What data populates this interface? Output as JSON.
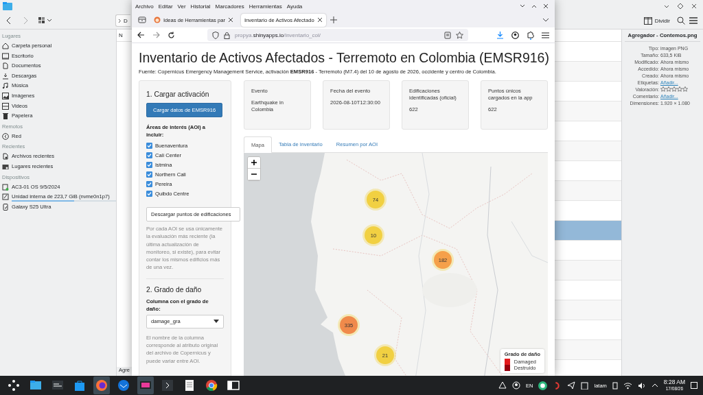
{
  "file_manager": {
    "breadcrumb": "D",
    "split_button": "Dividir",
    "column_header": "N",
    "status": "Agre",
    "places": [
      {
        "heading": "Lugares",
        "items": [
          {
            "label": "Carpeta personal",
            "kind": "home"
          },
          {
            "label": "Escritorio",
            "kind": "desktop"
          },
          {
            "label": "Documentos",
            "kind": "documents"
          },
          {
            "label": "Descargas",
            "kind": "downloads"
          },
          {
            "label": "Música",
            "kind": "music"
          },
          {
            "label": "Imágenes",
            "kind": "pictures"
          },
          {
            "label": "Videos",
            "kind": "videos"
          },
          {
            "label": "Papelera",
            "kind": "trash"
          }
        ]
      },
      {
        "heading": "Remotos",
        "items": [
          {
            "label": "Red",
            "kind": "network"
          }
        ]
      },
      {
        "heading": "Recientes",
        "items": [
          {
            "label": "Archivos recientes",
            "kind": "recent-files"
          },
          {
            "label": "Lugares recientes",
            "kind": "recent-places"
          }
        ]
      },
      {
        "heading": "Dispositivos",
        "items": [
          {
            "label": "AC3-01 OS 9/5/2024",
            "kind": "drive"
          },
          {
            "label": "Unidad interna de 223,7 GiB (nvme0n1p7)",
            "kind": "disk",
            "level": 0.6
          },
          {
            "label": "Galaxy S25 Ultra",
            "kind": "phone"
          }
        ]
      }
    ],
    "file_rows": [
      {
        "selected": false
      },
      {
        "selected": false
      },
      {
        "selected": false
      },
      {
        "selected": false
      },
      {
        "selected": false
      },
      {
        "selected": false
      },
      {
        "selected": false
      },
      {
        "selected": false
      },
      {
        "selected": false
      },
      {
        "selected": true
      },
      {
        "selected": false
      },
      {
        "selected": false
      },
      {
        "selected": false
      },
      {
        "selected": false
      },
      {
        "selected": false
      },
      {
        "selected": false
      }
    ],
    "info_panel": {
      "title": "Agregador - Contemos.png",
      "rows": [
        {
          "label": "Tipo:",
          "value": "imagen PNG",
          "kind": "text"
        },
        {
          "label": "Tamaño:",
          "value": "633,5 KiB",
          "kind": "text"
        },
        {
          "label": "Modificado:",
          "value": "Ahora mismo",
          "kind": "text"
        },
        {
          "label": "Accedido:",
          "value": "Ahora mismo",
          "kind": "text"
        },
        {
          "label": "Creado:",
          "value": "Ahora mismo",
          "kind": "text"
        },
        {
          "label": "Etiquetas:",
          "value": "Añadir...",
          "kind": "link"
        },
        {
          "label": "Valoración:",
          "kind": "stars",
          "stars": 0
        },
        {
          "label": "Comentario:",
          "value": "Añadir...",
          "kind": "link"
        },
        {
          "label": "Dimensiones:",
          "value": "1.920 × 1.080",
          "kind": "text"
        }
      ]
    }
  },
  "browser": {
    "menu": [
      "Archivo",
      "Editar",
      "Ver",
      "Historial",
      "Marcadores",
      "Herramientas",
      "Ayuda"
    ],
    "tabs": [
      {
        "title": "Ideas de Herramientas par",
        "selected": false
      },
      {
        "title": "Inventario de Activos Afectado",
        "selected": true
      }
    ],
    "url": [
      {
        "text": "propya.",
        "kind": "dim"
      },
      {
        "text": "shinyapps.io",
        "kind": "domain"
      },
      {
        "text": "/inventario_col/",
        "kind": "dim"
      }
    ],
    "page": {
      "title": "Inventario de Activos Afectados - Terremoto en Colombia (EMSR916)",
      "source": "Fuente: Copernicus Emergency Management Service, activación **EMSR916** - Terremoto (M7.4) del 10 de agosto de 2026, occidente y centro de Colombia.",
      "section_1": {
        "heading": "1. Cargar activación",
        "load_button": "Cargar datos de EMSR916",
        "aoi_label": "Áreas de interés (AOI) a incluir:",
        "aois": [
          {
            "label": "Buenaventura",
            "checked": true
          },
          {
            "label": "Cali Center",
            "checked": true
          },
          {
            "label": "Istmina",
            "checked": true
          },
          {
            "label": "Northern Cali",
            "checked": true
          },
          {
            "label": "Pereira",
            "checked": true
          },
          {
            "label": "Quibdo Centre",
            "checked": true
          }
        ],
        "download_button": "Descargar puntos de edificaciones",
        "note": "Por cada AOI se usa únicamente la evaluación más reciente (la última actualización de monitoreo, si existe), para evitar contar los mismos edificios más de una vez."
      },
      "section_2": {
        "heading": "2. Grado de daño",
        "column_label": "Columna con el grado de daño:",
        "select_value": "damage_gra",
        "note": "El nombre de la columna corresponde al atributo original del archivo de Copernicus y puede variar entre AOI."
      },
      "value_boxes": [
        {
          "label": "Evento",
          "value": "Earthquake in Colombia"
        },
        {
          "label": "Fecha del evento",
          "value": "2026-08-10T12:30:00"
        },
        {
          "label": "Edificaciones identificadas (oficial)",
          "value": "622"
        },
        {
          "label": "Puntos únicos cargados en la app",
          "value": "622"
        }
      ],
      "tabs": [
        {
          "label": "Mapa",
          "selected": true
        },
        {
          "label": "Tabla de inventario",
          "selected": false
        },
        {
          "label": "Resumen por AOI",
          "selected": false
        }
      ],
      "map": {
        "clusters": [
          {
            "count": "74",
            "color": "#f1d042"
          },
          {
            "count": "10",
            "color": "#f1d042"
          },
          {
            "count": "182",
            "color": "#f5a04a"
          },
          {
            "count": "335",
            "color": "#f08a4b"
          },
          {
            "count": "21",
            "color": "#f1d042"
          }
        ],
        "legend": {
          "title": "Grado de daño",
          "items": [
            {
              "label": "Damaged",
              "color": "#e31a1c"
            },
            {
              "label": "Destruido",
              "color": "#99000d"
            }
          ]
        }
      }
    }
  },
  "taskbar": {
    "apps": [
      {
        "kind": "launcher",
        "active": false
      },
      {
        "kind": "files",
        "active": false
      },
      {
        "kind": "monitor",
        "active": false
      },
      {
        "kind": "store",
        "active": false
      },
      {
        "kind": "firefox",
        "active": true
      },
      {
        "kind": "mail",
        "active": false
      },
      {
        "kind": "screen",
        "active": true
      },
      {
        "kind": "terminal",
        "active": false
      },
      {
        "kind": "notes",
        "active": false
      },
      {
        "kind": "chrome",
        "active": false
      },
      {
        "kind": "window",
        "active": false
      }
    ],
    "keyboard": "EN",
    "layout": "latam",
    "time": "8:28 AM",
    "date": "17/08/26"
  }
}
